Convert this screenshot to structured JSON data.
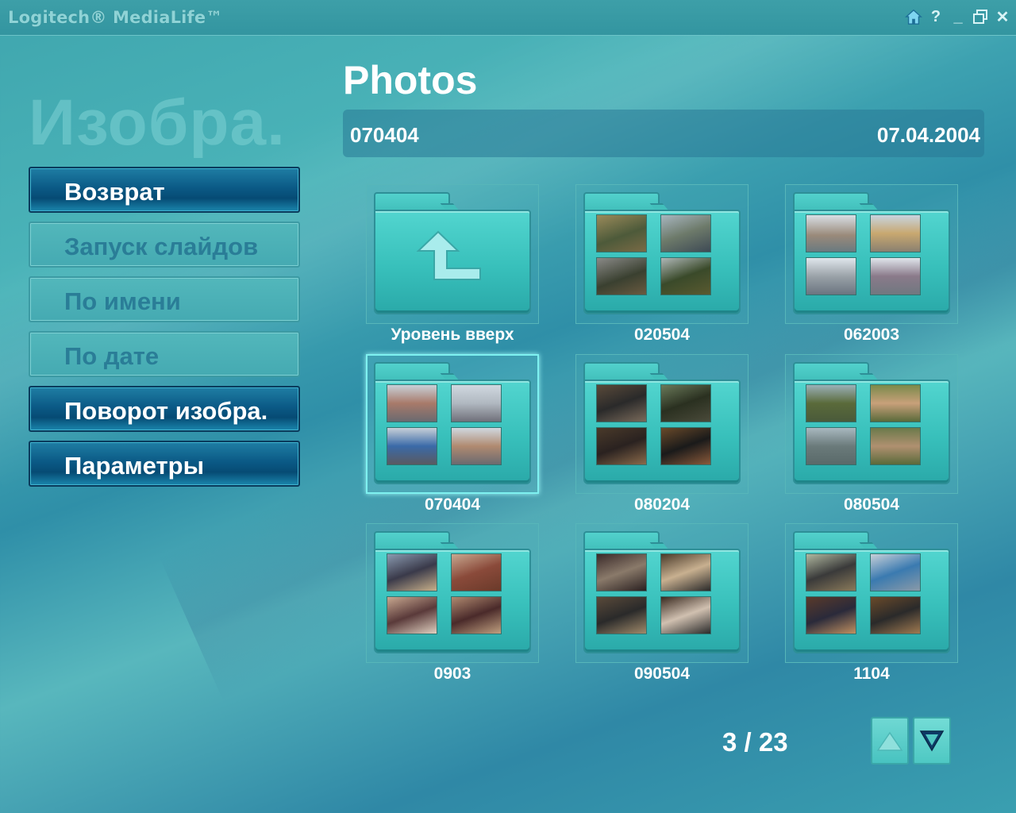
{
  "app": {
    "title": "Logitech® MediaLife™"
  },
  "window_controls": [
    {
      "name": "home-icon",
      "label": ""
    },
    {
      "name": "help-icon",
      "label": "?"
    },
    {
      "name": "minimize-icon",
      "label": "_"
    },
    {
      "name": "restore-icon",
      "label": ""
    },
    {
      "name": "close-icon",
      "label": "✕"
    }
  ],
  "watermark": "Изобра.",
  "header": {
    "title": "Photos",
    "folder": "070404",
    "date": "07.04.2004"
  },
  "menu": [
    {
      "label": "Возврат",
      "enabled": true
    },
    {
      "label": "Запуск слайдов",
      "enabled": false
    },
    {
      "label": "По имени",
      "enabled": false
    },
    {
      "label": "По дате",
      "enabled": false
    },
    {
      "label": "Поворот изобра.",
      "enabled": true
    },
    {
      "label": "Параметры",
      "enabled": true
    }
  ],
  "folders": [
    {
      "label": "Уровень вверх",
      "type": "up"
    },
    {
      "label": "020504",
      "type": "folder"
    },
    {
      "label": "062003",
      "type": "folder"
    },
    {
      "label": "070404",
      "type": "folder",
      "selected": true
    },
    {
      "label": "080204",
      "type": "folder"
    },
    {
      "label": "080504",
      "type": "folder"
    },
    {
      "label": "0903",
      "type": "folder"
    },
    {
      "label": "090504",
      "type": "folder"
    },
    {
      "label": "1104",
      "type": "folder"
    }
  ],
  "pager": {
    "text": "3 / 23"
  },
  "colors": {
    "accent": "#0b5a86",
    "background": "#3fa6ae",
    "selected_glow": "#7ef1f0"
  }
}
